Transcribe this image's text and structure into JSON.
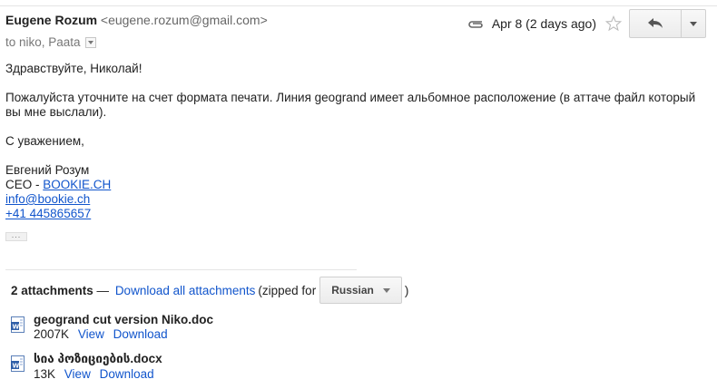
{
  "header": {
    "sender_name": "Eugene Rozum",
    "sender_email": "<eugene.rozum@gmail.com>",
    "to_line": "to niko, Paata",
    "date": "Apr 8 (2 days ago)"
  },
  "body": {
    "greeting": "Здравствуйте, Николай!",
    "paragraph": "Пожалуйста уточните на счет формата печати. Линия geogrand имеет альбомное расположение (в аттаче файл который вы мне выслали).",
    "closing": "С уважением,",
    "signature_name": "Евгений Розум",
    "signature_title_prefix": "CEO - ",
    "signature_company_link": "BOOKIE.CH",
    "signature_email_link": "info@bookie.ch",
    "signature_phone_link": "+41 445865657",
    "show_trimmed": "..."
  },
  "attachments": {
    "count_label": "2 attachments",
    "separator": " — ",
    "download_all": "Download all attachments",
    "zipped_for": "(zipped for",
    "language": "Russian",
    "close_paren": ")",
    "items": [
      {
        "name": "geogrand cut version Niko.doc",
        "size": "2007K",
        "view": "View",
        "download": "Download"
      },
      {
        "name": "სია პოზიციების.docx",
        "size": "13K",
        "view": "View",
        "download": "Download"
      }
    ]
  },
  "colors": {
    "link": "#1155cc",
    "text": "#222222",
    "muted": "#777777"
  }
}
